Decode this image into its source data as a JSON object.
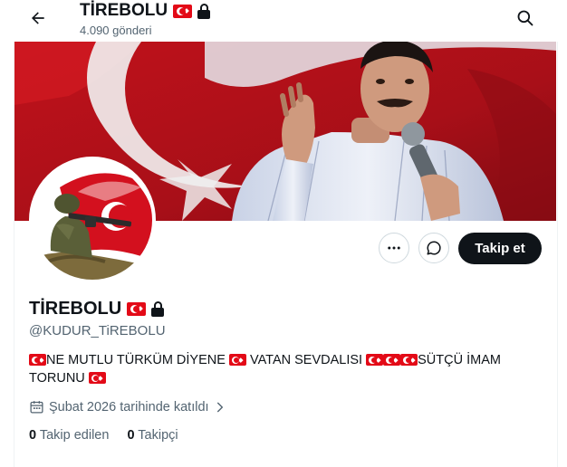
{
  "header": {
    "title": "TİREBOLU",
    "post_count": "4.090 gönderi"
  },
  "profile": {
    "display_name": "TİREBOLU",
    "handle": "@KUDUR_TiREBOLU",
    "bio_part1": "NE MUTLU TÜRKÜM DİYENE",
    "bio_part2": "VATAN SEVDALISI",
    "bio_part3": "SÜTÇÜ İMAM TORUNU",
    "joined": "Şubat 2026 tarihinde katıldı",
    "following_count": "0",
    "following_label": "Takip edilen",
    "followers_count": "0",
    "followers_label": "Takipçi"
  },
  "actions": {
    "follow_label": "Takip et"
  },
  "icons": [
    "back-arrow-icon",
    "search-icon",
    "turkish-flag-icon",
    "lock-icon",
    "more-icon",
    "message-icon",
    "calendar-icon",
    "chevron-right-icon"
  ],
  "colors": {
    "follow_button": "#0f1419",
    "secondary_text": "#536471",
    "flag_red": "#e30a17"
  }
}
